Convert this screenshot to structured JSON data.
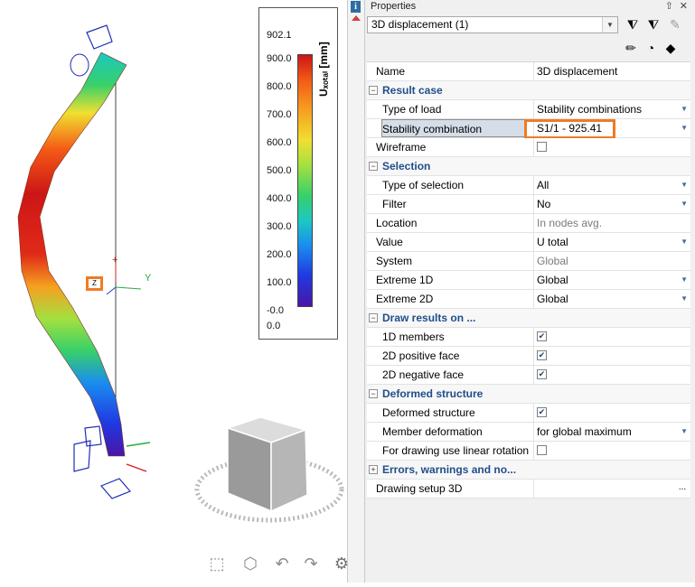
{
  "panel": {
    "title": "Properties",
    "pin": "⇧",
    "close": "✕",
    "selector_value": "3D displacement (1)"
  },
  "legend": {
    "max_label": "902.1",
    "unit": "Uₓₒₜₐₗ [mm]",
    "ticks": [
      "900.0",
      "800.0",
      "700.0",
      "600.0",
      "500.0",
      "400.0",
      "300.0",
      "200.0",
      "100.0",
      "-0.0",
      "0.0"
    ]
  },
  "viewport": {
    "axis_labels": {
      "z_top": "+",
      "y": "Y",
      "z_box": "Z"
    }
  },
  "properties": [
    {
      "type": "row",
      "name": "Name",
      "value": "3D displacement"
    },
    {
      "type": "section",
      "name": "Result case",
      "expanded": true
    },
    {
      "type": "row",
      "indent": true,
      "name": "Type of load",
      "value": "Stability combinations",
      "dropdown": true
    },
    {
      "type": "row",
      "indent": true,
      "selected": true,
      "highlight": true,
      "name": "Stability combination",
      "value": "S1/1 - 925.41",
      "dropdown": true
    },
    {
      "type": "row",
      "name": "Wireframe",
      "checkbox": false
    },
    {
      "type": "section",
      "name": "Selection",
      "expanded": true
    },
    {
      "type": "row",
      "indent": true,
      "name": "Type of selection",
      "value": "All",
      "dropdown": true
    },
    {
      "type": "row",
      "indent": true,
      "name": "Filter",
      "value": "No",
      "dropdown": true
    },
    {
      "type": "row",
      "name": "Location",
      "value": "In nodes avg.",
      "gray": true
    },
    {
      "type": "row",
      "name": "Value",
      "value": "U total",
      "dropdown": true
    },
    {
      "type": "row",
      "name": "System",
      "value": "Global",
      "gray": true
    },
    {
      "type": "row",
      "name": "Extreme 1D",
      "value": "Global",
      "dropdown": true
    },
    {
      "type": "row",
      "name": "Extreme 2D",
      "value": "Global",
      "dropdown": true
    },
    {
      "type": "section",
      "name": "Draw results on ...",
      "expanded": true
    },
    {
      "type": "row",
      "indent": true,
      "name": "1D members",
      "checkbox": true
    },
    {
      "type": "row",
      "indent": true,
      "name": "2D positive face",
      "checkbox": true
    },
    {
      "type": "row",
      "indent": true,
      "name": "2D negative face",
      "checkbox": true
    },
    {
      "type": "section",
      "name": "Deformed structure",
      "expanded": true
    },
    {
      "type": "row",
      "indent": true,
      "name": "Deformed structure",
      "checkbox": true
    },
    {
      "type": "row",
      "indent": true,
      "name": "Member deformation",
      "value": "for global maximum",
      "dropdown": true
    },
    {
      "type": "row",
      "indent": true,
      "name": "For drawing use linear rotation",
      "checkbox": false
    },
    {
      "type": "section",
      "name": "Errors, warnings and no...",
      "expanded": false
    },
    {
      "type": "row",
      "name": "Drawing setup 3D",
      "value": "",
      "ellipsis": true
    }
  ],
  "icons": {
    "tb1": "funnel-icon",
    "tb2": "funnel-add-icon",
    "tb3": "pencil-icon",
    "tb4": "brush-icon",
    "tb5": "pie-icon",
    "tb6": "render-icon",
    "vb1": "zoom-selection-icon",
    "vb2": "view-cube-icon",
    "vb3": "undo-view-icon",
    "vb4": "redo-view-icon",
    "vb5": "settings-gear-icon"
  },
  "colors": {
    "highlight": "#f07b22",
    "section_text": "#1f4e8a"
  }
}
